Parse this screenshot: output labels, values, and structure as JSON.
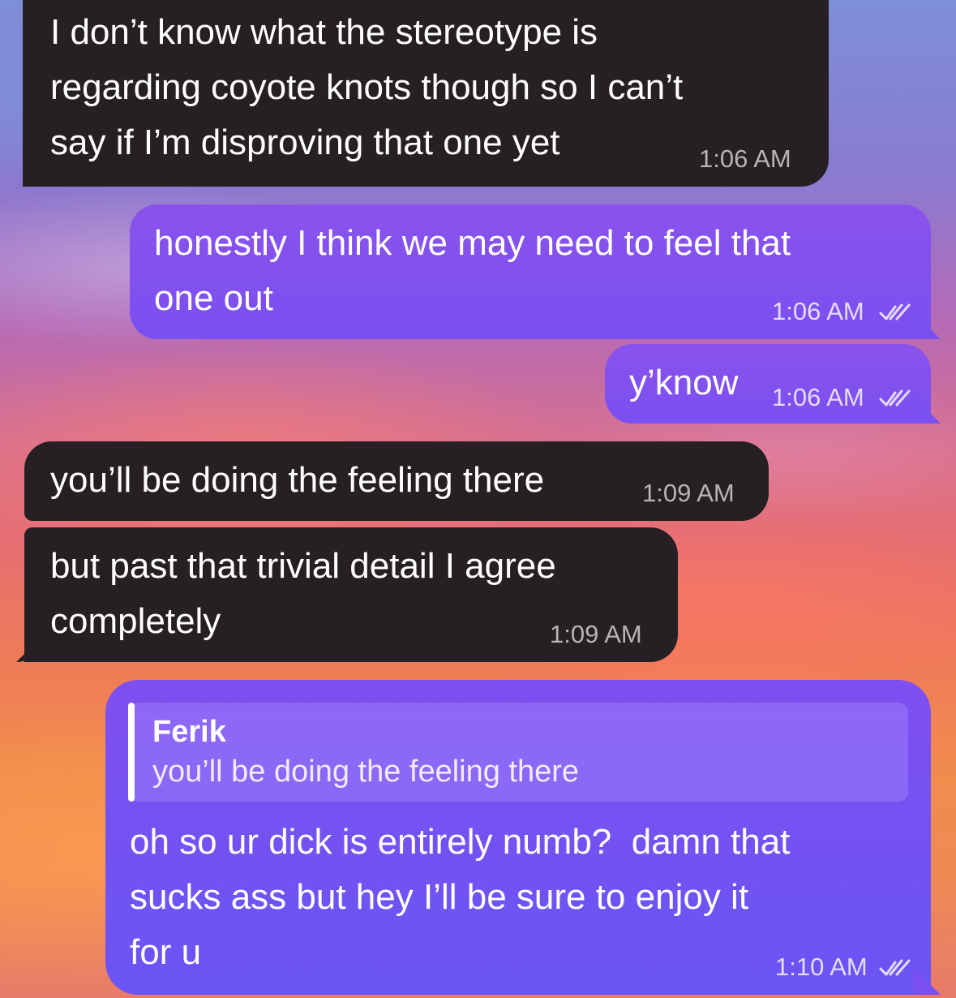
{
  "messages": [
    {
      "direction": "incoming",
      "text": "I don’t know what the stereotype is\nregarding coyote knots though so I can’t\nsay if I’m disproving that one yet",
      "time": "1:06 AM"
    },
    {
      "direction": "outgoing",
      "text": "honestly I think we may need to feel that\none out",
      "time": "1:06 AM",
      "status_icon": "double-check-icon"
    },
    {
      "direction": "outgoing",
      "text": "y’know",
      "time": "1:06 AM",
      "status_icon": "double-check-icon"
    },
    {
      "direction": "incoming",
      "text": "you’ll be doing the feeling there",
      "time": "1:09 AM"
    },
    {
      "direction": "incoming",
      "text": "but past that trivial detail I agree\ncompletely",
      "time": "1:09 AM"
    },
    {
      "direction": "outgoing",
      "reply": {
        "name": "Ferik",
        "text": "you’ll be doing the feeling there"
      },
      "text": "oh so ur dick is entirely numb?  damn that\nsucks ass but hey I’ll be sure to enjoy it\nfor u",
      "time": "1:10 AM",
      "status_icon": "double-check-icon"
    }
  ],
  "colors": {
    "incoming_bubble": "#262024",
    "outgoing_bubble": "#7a50f0",
    "text": "#ffffff"
  }
}
